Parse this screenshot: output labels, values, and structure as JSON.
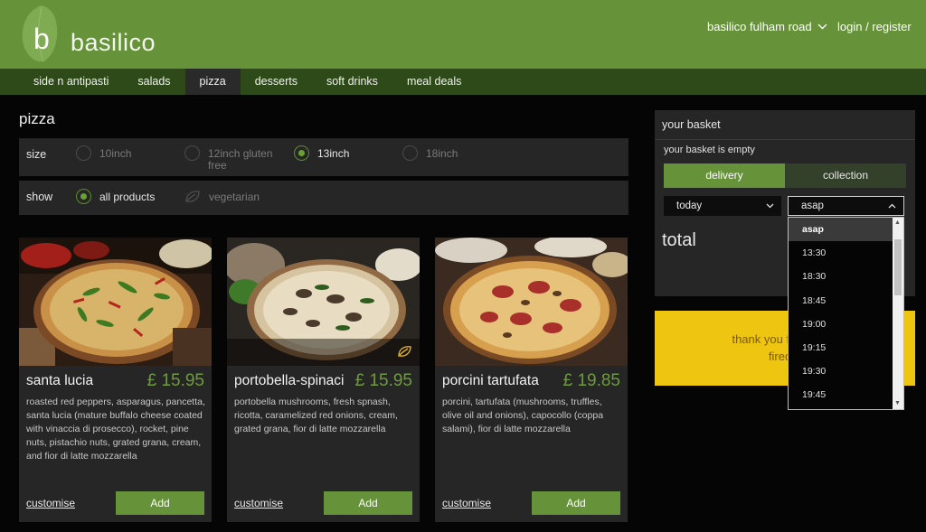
{
  "header": {
    "logo_letter": "b",
    "brand": "basilico",
    "store": "basilico fulham road",
    "login": "login / register"
  },
  "nav": {
    "items": [
      {
        "label": "side n antipasti",
        "active": false
      },
      {
        "label": "salads",
        "active": false
      },
      {
        "label": "pizza",
        "active": true
      },
      {
        "label": "desserts",
        "active": false
      },
      {
        "label": "soft drinks",
        "active": false
      },
      {
        "label": "meal deals",
        "active": false
      }
    ]
  },
  "page": {
    "title": "pizza"
  },
  "filters": {
    "size_label": "size",
    "size_options": [
      {
        "label": "10inch",
        "checked": false
      },
      {
        "label": "12inch gluten free",
        "checked": false
      },
      {
        "label": "13inch",
        "checked": true
      },
      {
        "label": "18inch",
        "checked": false
      }
    ],
    "show_label": "show",
    "show_options": [
      {
        "label": "all products",
        "checked": true
      },
      {
        "label": "vegetarian",
        "checked": false
      }
    ]
  },
  "products": [
    {
      "name": "santa lucia",
      "price": "£ 15.95",
      "description": "roasted red peppers, asparagus, pancetta, santa lucia (mature buffalo cheese coated with vinaccia di prosecco), rocket, pine nuts, pistachio nuts, grated grana, cream, and fior di latte mozzarella",
      "customise": "customise",
      "add": "Add",
      "vegetarian_icon": false
    },
    {
      "name": "portobella-spinaci",
      "price": "£ 15.95",
      "description": "portobella mushrooms, fresh spnash, ricotta, caramelized red onions, cream, grated grana, fior di latte mozzarella",
      "customise": "customise",
      "add": "Add",
      "vegetarian_icon": true
    },
    {
      "name": "porcini tartufata",
      "price": "£ 19.85",
      "description": "porcini, tartufata (mushrooms, truffles, olive oil and onions), capocollo (coppa salami), fior di latte mozzarella",
      "customise": "customise",
      "add": "Add",
      "vegetarian_icon": false
    }
  ],
  "basket": {
    "title": "your basket",
    "empty_text": "your basket is empty",
    "delivery": "delivery",
    "collection": "collection",
    "day": "today",
    "time": "asap",
    "total_label": "total"
  },
  "promo": {
    "line1": "thank you for buying",
    "line2": "fired p"
  },
  "time_dropdown": {
    "options": [
      "asap",
      "13:30",
      "18:30",
      "18:45",
      "19:00",
      "19:15",
      "19:30",
      "19:45"
    ],
    "selected": "asap"
  },
  "colors": {
    "brand_green": "#66923a",
    "nav_dark": "#2e4a18",
    "price_green": "#6d9c3a",
    "promo_yellow": "#eec510"
  }
}
